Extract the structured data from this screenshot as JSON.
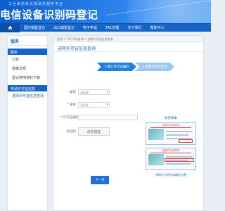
{
  "banner": {
    "subtitle": "工业和信息化部政务服务平台",
    "title": "电信设备识别码登记"
  },
  "nav": {
    "items": [
      {
        "label": "国内销售登记"
      },
      {
        "label": "出口销售登记"
      },
      {
        "label": "电子申请"
      },
      {
        "label": "TAC管理"
      },
      {
        "label": "关于我们"
      },
      {
        "label": "帮助中心"
      }
    ]
  },
  "sidebar": {
    "heading": "服务",
    "section1": "服务",
    "links": [
      {
        "label": "公告"
      },
      {
        "label": "政策法规"
      },
      {
        "label": "登记常用资料下载"
      }
    ],
    "section2": "申请许可证信息",
    "active_link": "进网许可证信息查询"
  },
  "main": {
    "breadcrumb": "首页 > TAC号码查询 > 进网许可证信息查询",
    "title": "进网许可证信息查询",
    "steps": [
      "1.输入许可证编码",
      "2.查看识别码信息"
    ],
    "form": {
      "field1_label": "* 类别",
      "field1_value": "请选择",
      "field2_label": "* 省份",
      "field2_value": "请选择",
      "field3_label": "* 许可证编码",
      "field3_placeholder": "",
      "captcha_label": "验证码",
      "captcha_button": "点击验证",
      "next_button": "下一步"
    },
    "samples": {
      "title": "标志样本",
      "card1_header": "进网许可证样本",
      "card2_header": "进网许可证样本",
      "caption": "进网许可证样本编号位置"
    }
  },
  "colors": {
    "primary": "#1565c8",
    "accent": "#1e7fe0",
    "banner": "#0b5ed0"
  }
}
